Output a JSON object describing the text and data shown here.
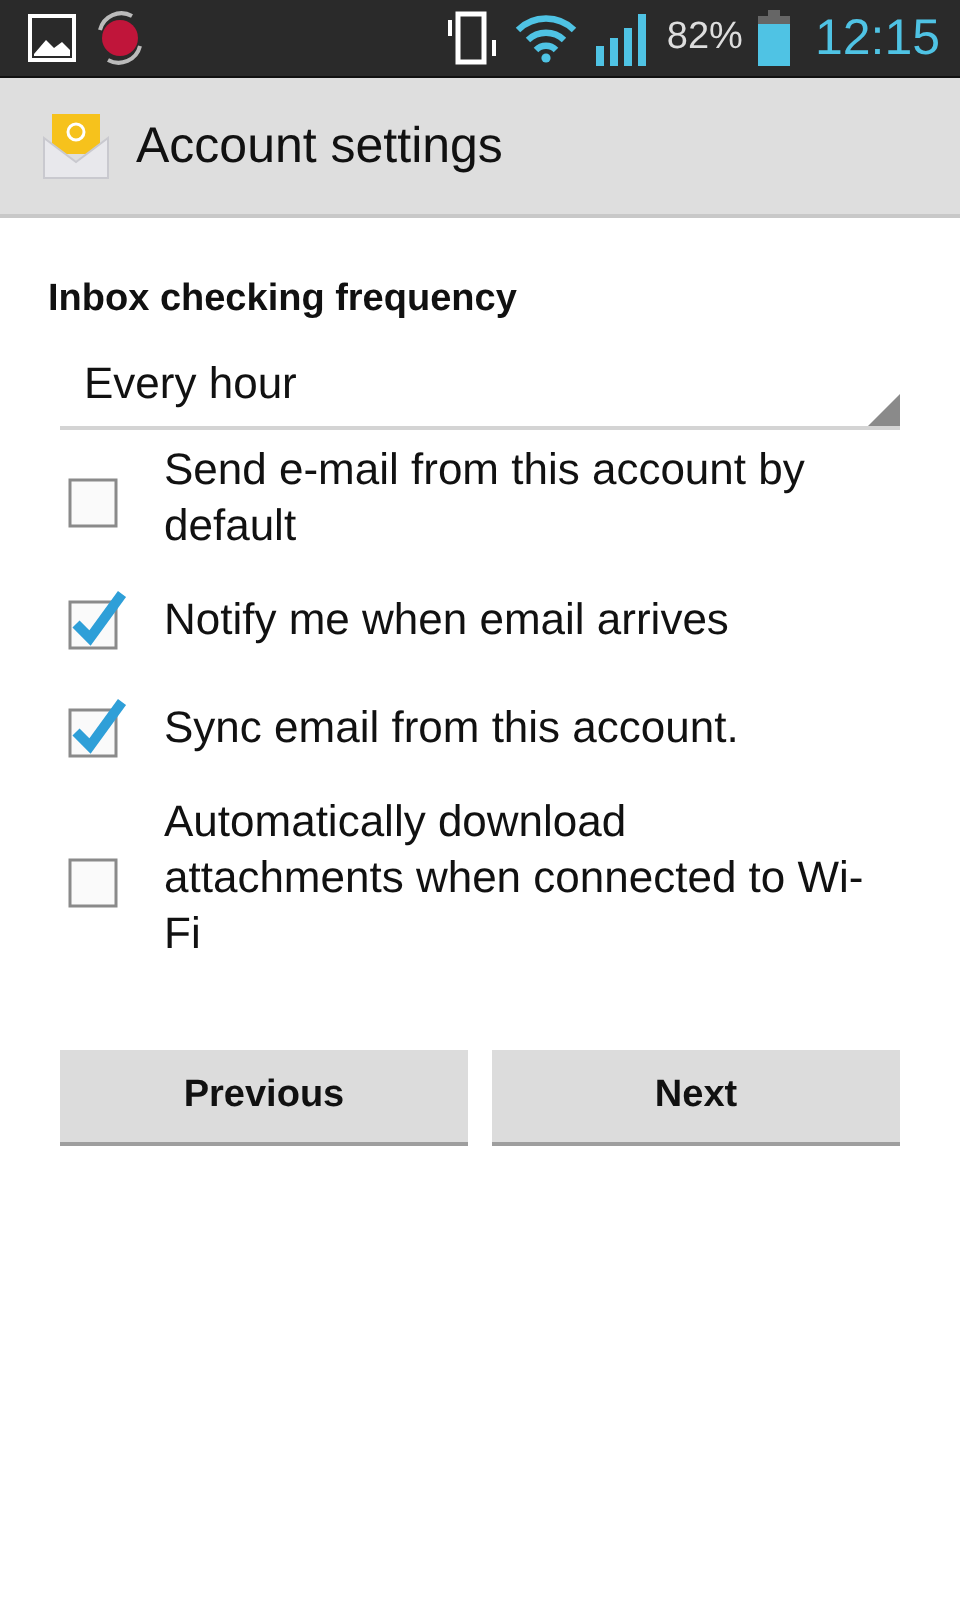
{
  "status_bar": {
    "battery": "82%",
    "time": "12:15"
  },
  "action_bar": {
    "title": "Account settings"
  },
  "frequency": {
    "label": "Inbox checking frequency",
    "value": "Every hour"
  },
  "options": [
    {
      "label": "Send e-mail from this account by default",
      "checked": false
    },
    {
      "label": "Notify me when email arrives",
      "checked": true
    },
    {
      "label": "Sync email from this account.",
      "checked": true
    },
    {
      "label": "Automatically download attachments when connected to Wi-Fi",
      "checked": false
    }
  ],
  "buttons": [
    "Previous",
    "Next"
  ]
}
